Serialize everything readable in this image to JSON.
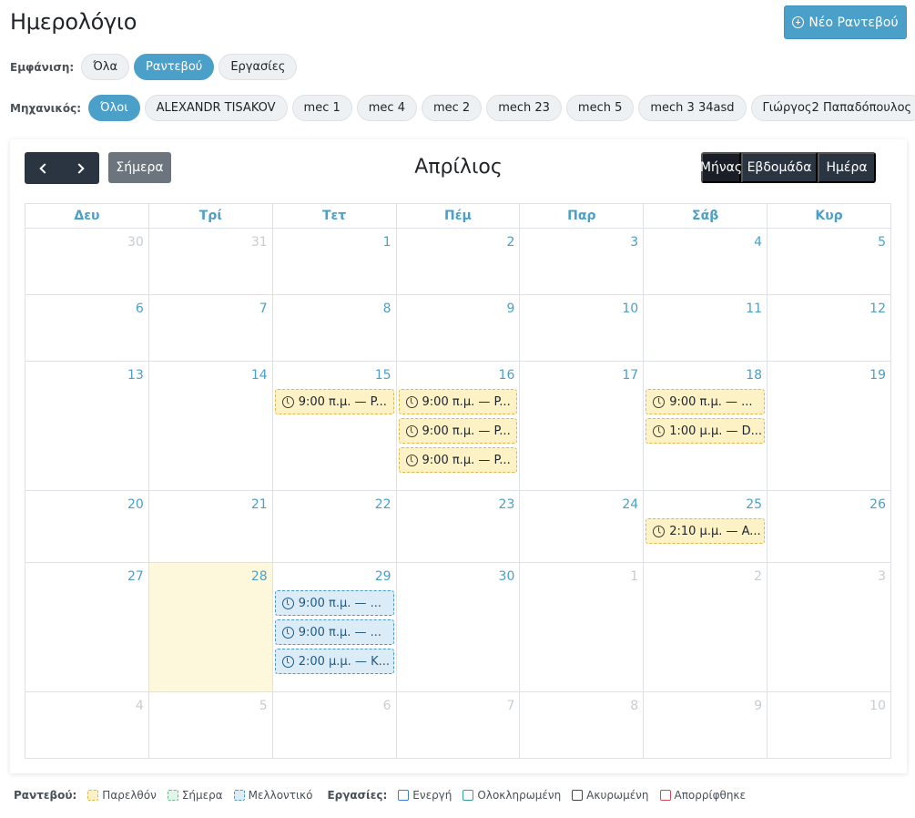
{
  "page": {
    "title": "Ημερολόγιο",
    "new_button": "Νέο Ραντεβού"
  },
  "filters": {
    "view": {
      "label": "Εμφάνιση:",
      "options": [
        "Όλα",
        "Ραντεβού",
        "Εργασίες"
      ],
      "active": "Ραντεβού"
    },
    "mechanic": {
      "label": "Μηχανικός:",
      "options": [
        "Όλοι",
        "ALEXANDR TISAKOV",
        "mec 1",
        "mec 4",
        "mec 2",
        "mech 23",
        "mech 5",
        "mech 3 34asd",
        "Γιώργος2 Παπαδόπουλος"
      ],
      "active": "Όλοι"
    }
  },
  "calendar": {
    "month_title": "Απρίλιος",
    "today_button": "Σήμερα",
    "prev_icon": "chevron-left-icon",
    "next_icon": "chevron-right-icon",
    "views": [
      "Μήνας",
      "Εβδομάδα",
      "Ημέρα"
    ],
    "active_view": "Μήνας",
    "weekdays": [
      "Δευ",
      "Τρί",
      "Τετ",
      "Πέμ",
      "Παρ",
      "Σάβ",
      "Κυρ"
    ],
    "weeks": [
      [
        {
          "day": "30",
          "other": true,
          "events": []
        },
        {
          "day": "31",
          "other": true,
          "events": []
        },
        {
          "day": "1",
          "events": []
        },
        {
          "day": "2",
          "events": []
        },
        {
          "day": "3",
          "events": []
        },
        {
          "day": "4",
          "events": []
        },
        {
          "day": "5",
          "events": []
        }
      ],
      [
        {
          "day": "6",
          "events": []
        },
        {
          "day": "7",
          "events": []
        },
        {
          "day": "8",
          "events": []
        },
        {
          "day": "9",
          "events": []
        },
        {
          "day": "10",
          "events": []
        },
        {
          "day": "11",
          "events": []
        },
        {
          "day": "12",
          "events": []
        }
      ],
      [
        {
          "day": "13",
          "events": []
        },
        {
          "day": "14",
          "events": []
        },
        {
          "day": "15",
          "events": [
            {
              "text": "9:00 π.μ. — P...",
              "status": "past"
            }
          ]
        },
        {
          "day": "16",
          "events": [
            {
              "text": "9:00 π.μ. — P...",
              "status": "past"
            },
            {
              "text": "9:00 π.μ. — P...",
              "status": "past"
            },
            {
              "text": "9:00 π.μ. — P...",
              "status": "past"
            }
          ]
        },
        {
          "day": "17",
          "events": []
        },
        {
          "day": "18",
          "events": [
            {
              "text": "9:00 π.μ. — ...",
              "status": "past"
            },
            {
              "text": "1:00 μ.μ. — D...",
              "status": "past"
            }
          ]
        },
        {
          "day": "19",
          "events": []
        }
      ],
      [
        {
          "day": "20",
          "events": []
        },
        {
          "day": "21",
          "events": []
        },
        {
          "day": "22",
          "events": []
        },
        {
          "day": "23",
          "events": []
        },
        {
          "day": "24",
          "events": []
        },
        {
          "day": "25",
          "events": [
            {
              "text": "2:10 μ.μ. — A...",
              "status": "past"
            }
          ]
        },
        {
          "day": "26",
          "events": []
        }
      ],
      [
        {
          "day": "27",
          "events": []
        },
        {
          "day": "28",
          "today": true,
          "events": []
        },
        {
          "day": "29",
          "events": [
            {
              "text": "9:00 π.μ. — ...",
              "status": "future"
            },
            {
              "text": "9:00 π.μ. — ...",
              "status": "future"
            },
            {
              "text": "2:00 μ.μ. — K...",
              "status": "future"
            }
          ]
        },
        {
          "day": "30",
          "events": []
        },
        {
          "day": "1",
          "other": true,
          "events": []
        },
        {
          "day": "2",
          "other": true,
          "events": []
        },
        {
          "day": "3",
          "other": true,
          "events": []
        }
      ],
      [
        {
          "day": "4",
          "other": true,
          "events": []
        },
        {
          "day": "5",
          "other": true,
          "events": []
        },
        {
          "day": "6",
          "other": true,
          "events": []
        },
        {
          "day": "7",
          "other": true,
          "events": []
        },
        {
          "day": "8",
          "other": true,
          "events": []
        },
        {
          "day": "9",
          "other": true,
          "events": []
        },
        {
          "day": "10",
          "other": true,
          "events": []
        }
      ]
    ]
  },
  "legend": {
    "appointments_title": "Ραντεβού:",
    "appointments": [
      {
        "label": "Παρελθόν",
        "kind": "past"
      },
      {
        "label": "Σήμερα",
        "kind": "today"
      },
      {
        "label": "Μελλοντικό",
        "kind": "future"
      }
    ],
    "tasks_title": "Εργασίες:",
    "tasks": [
      {
        "label": "Ενεργή",
        "kind": "active"
      },
      {
        "label": "Ολοκληρωμένη",
        "kind": "done"
      },
      {
        "label": "Ακυρωμένη",
        "kind": "cancel"
      },
      {
        "label": "Απορρίφθηκε",
        "kind": "rejected"
      }
    ]
  },
  "colors": {
    "accent": "#4ba0c9",
    "dark_button": "#2b3542",
    "today_cell": "#fdf8dc",
    "past_event_bg": "#fdf1c6",
    "future_event_bg": "#dcecf7"
  }
}
